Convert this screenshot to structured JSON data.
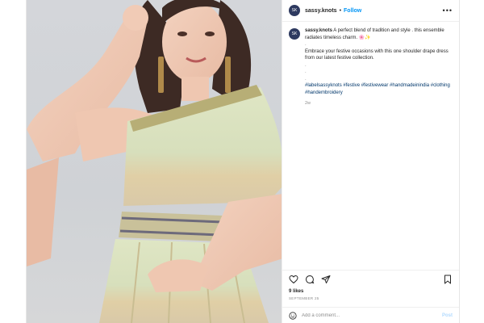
{
  "post": {
    "username": "sassy.knots",
    "avatar_text": "SK",
    "follow_label": "Follow",
    "more_icon": "more-horizontal-icon",
    "caption_username": "sassy.knots",
    "caption_line1": "A perfect blend of tradition and style . this ensemble radiates timeless charm. 🌸✨",
    "caption_sep1": ".",
    "caption_line2": "Embrace your festive occasions with this one shoulder drape dress from our latest festive collection.",
    "caption_sep2": ".",
    "caption_sep3": ".",
    "caption_sep4": ".",
    "hashtags": "#labelsassyknots #festive #festivewear #handmadeinindia #clothing #handembroidery",
    "age": "2w",
    "likes": "9 likes",
    "date": "SEPTEMBER 25",
    "comment_placeholder": "Add a comment...",
    "post_label": "Post"
  },
  "icons": {
    "like": "heart-icon",
    "comment": "comment-bubble-icon",
    "share": "paper-plane-icon",
    "save": "bookmark-icon",
    "emoji": "emoji-smiley-icon"
  },
  "colors": {
    "accent": "#0095f6",
    "text": "#262626",
    "muted": "#8e8e8e",
    "hashtag": "#00376b"
  }
}
